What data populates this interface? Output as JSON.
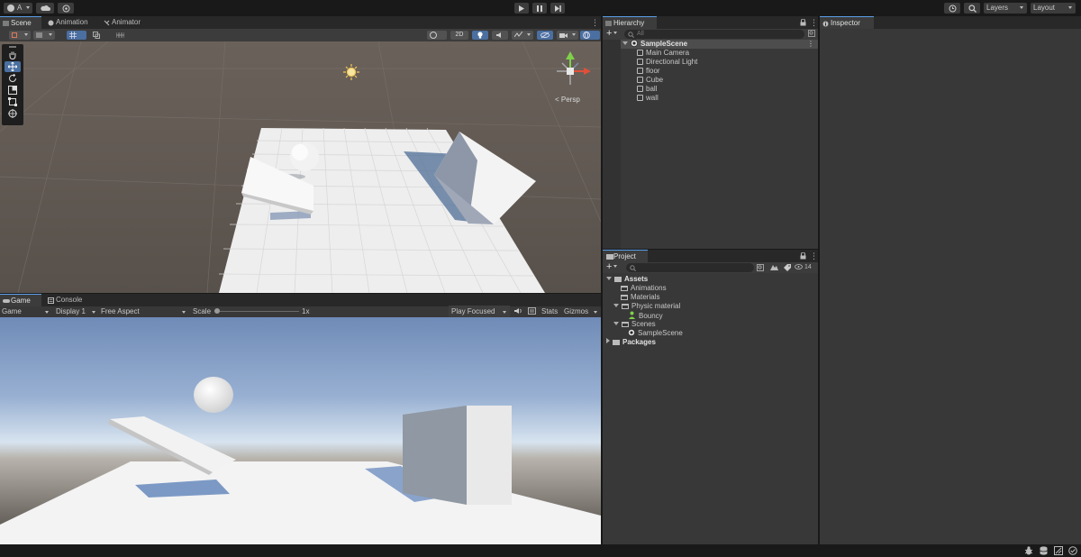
{
  "toolbar": {
    "account_label": "A",
    "layers_label": "Layers",
    "layout_label": "Layout"
  },
  "scene_tabs": [
    {
      "label": "Scene"
    },
    {
      "label": "Animation"
    },
    {
      "label": "Animator"
    }
  ],
  "scene_view": {
    "mode_2d_label": "2D",
    "persp_label": "< Persp"
  },
  "game_tabs": [
    {
      "label": "Game"
    },
    {
      "label": "Console"
    }
  ],
  "game_bar": {
    "view_select": "Game",
    "display_select": "Display 1",
    "aspect_select": "Free Aspect",
    "scale_label": "Scale",
    "scale_value": "1x",
    "play_mode_select": "Play Focused",
    "stats_label": "Stats",
    "gizmos_label": "Gizmos"
  },
  "hierarchy": {
    "tab_label": "Hierarchy",
    "search_placeholder": "All",
    "scene_name": "SampleScene",
    "items": [
      "Main Camera",
      "Directional Light",
      "floor",
      "Cube",
      "ball",
      "wall"
    ]
  },
  "project": {
    "tab_label": "Project",
    "count_badge": "14",
    "tree": {
      "assets": "Assets",
      "animations": "Animations",
      "materials": "Materials",
      "physic_material": "Physic material",
      "bouncy": "Bouncy",
      "scenes": "Scenes",
      "sample_scene": "SampleScene",
      "packages": "Packages"
    }
  },
  "inspector": {
    "tab_label": "Inspector"
  },
  "colors": {
    "accent": "#5a9ee8",
    "panel": "#383838",
    "tabbar": "#282828",
    "selection": "#4d4d4d"
  }
}
